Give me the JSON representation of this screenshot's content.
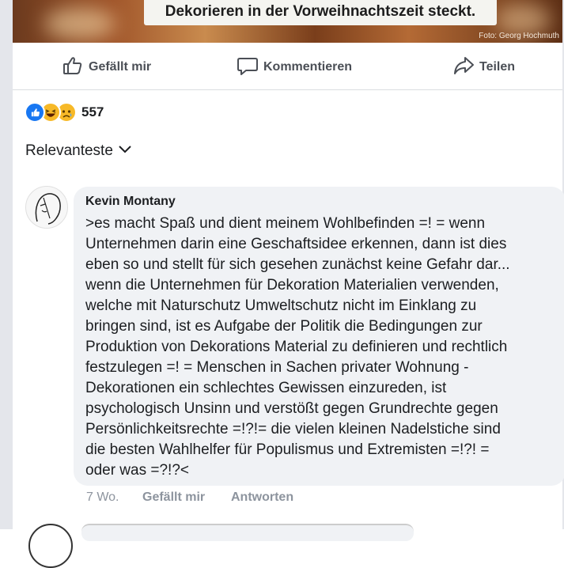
{
  "photo": {
    "caption": "Dekorieren in der Vorweihnachtszeit steckt.",
    "credit": "Foto: Georg Hochmuth"
  },
  "actions": {
    "like_label": "Gefällt mir",
    "comment_label": "Kommentieren",
    "share_label": "Teilen"
  },
  "reactions": {
    "icons": [
      "like-icon",
      "haha-icon",
      "sad-icon"
    ],
    "count": "557"
  },
  "sort": {
    "label": "Relevanteste"
  },
  "comment": {
    "author": "Kevin Montany",
    "text": ">es macht Spaß und dient meinem Wohlbefinden =! = wenn\nUnternehmen darin eine Geschaftsidee erkennen, dann ist dies\neben so und stellt für sich gesehen zunächst keine Gefahr dar...\nwenn die Unternehmen für Dekoration Materialien verwenden,\nwelche mit Naturschutz Umweltschutz nicht im Einklang zu\nbringen sind, ist es Aufgabe der Politik die Bedingungen zur\nProduktion von Dekorations Material zu definieren und rechtlich\nfestzulegen =! = Menschen in Sachen privater Wohnung -\nDekorationen ein schlechtes Gewissen einzureden, ist\npsychologisch Unsinn und verstößt gegen Grundrechte gegen\nPersönlichkeitsrechte =!?!= die vielen kleinen Nadelstiche sind\ndie besten Wahlhelfer für Populismus und Extremisten =!?! =\noder was =?!?<",
    "time": "7 Wo.",
    "like_label": "Gefällt mir",
    "reply_label": "Antworten"
  },
  "colors": {
    "like_blue": "#1877f2",
    "reaction_yellow": "#f7b928",
    "muted_text": "#8d949e",
    "bubble_bg": "#f0f2f5"
  }
}
